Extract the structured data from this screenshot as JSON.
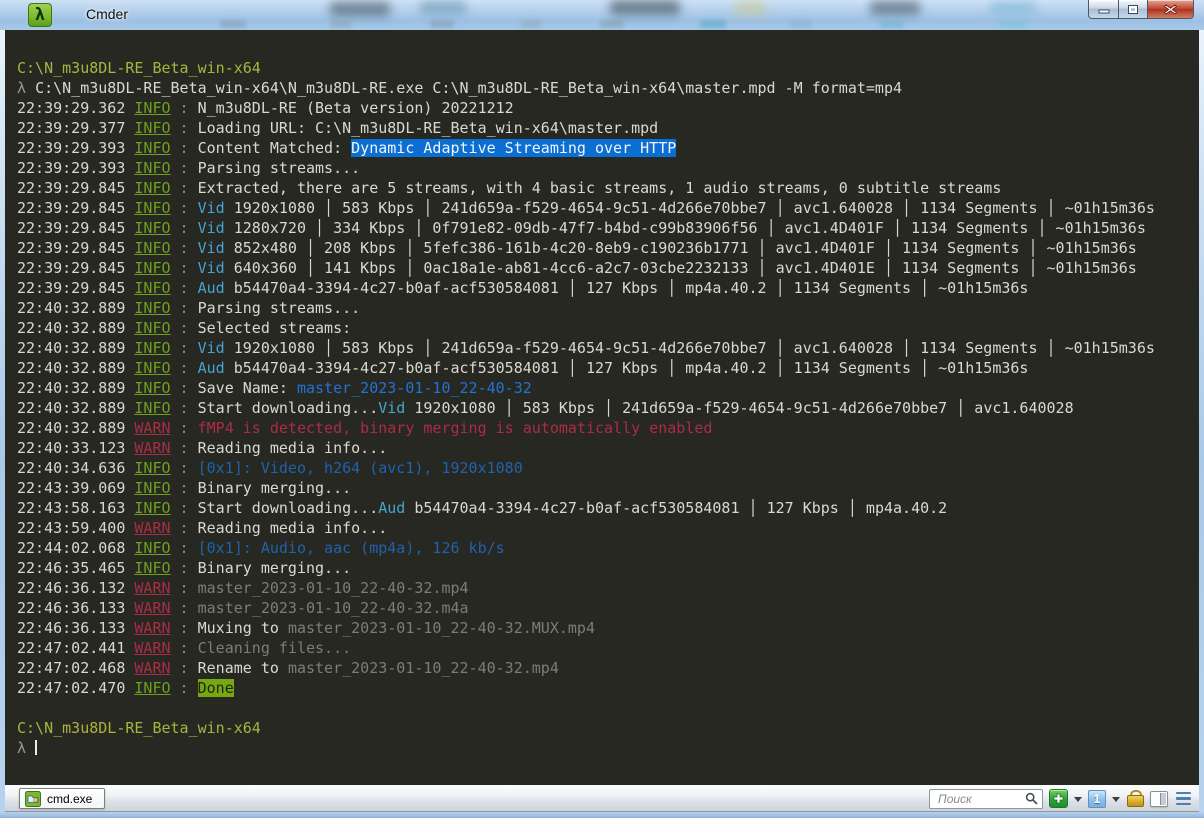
{
  "window": {
    "title": "Cmder",
    "logo_glyph": "λ",
    "buttons": [
      "minimize",
      "maximize",
      "close"
    ]
  },
  "palette": {
    "bg": "#272822",
    "fg": "#d9d9d0",
    "dim": "#7d7d74",
    "path": "#a9b43f",
    "lambda": "#9a9a92",
    "sep": "#8f8f85",
    "info": "#6fa01e",
    "warn": "#ab2c44",
    "vid": "#45a3cf",
    "link": "#2272d4",
    "binfo": "#1f63ae",
    "hl_bg": "#0a6ed2",
    "hl_fg": "#f2f6fa",
    "done_bg": "#76a812",
    "done_fg": "#1e2414",
    "logo_green": "#7cb82f",
    "close_red": "#c0452f"
  },
  "terminal": {
    "lines": [
      [
        {
          "t": "C:\\N_m3u8DL-RE_Beta_win-x64",
          "s": "path"
        }
      ],
      [
        {
          "t": "λ ",
          "s": "lambda"
        },
        {
          "t": "C:\\N_m3u8DL-RE_Beta_win-x64\\N_m3u8DL-RE.exe C:\\N_m3u8DL-RE_Beta_win-x64\\master.mpd -M format=mp4",
          "s": "default"
        }
      ],
      [
        {
          "t": "22:39:29.362 ",
          "s": "default"
        },
        {
          "t": "INFO",
          "s": "info"
        },
        {
          "t": " : ",
          "s": "sep"
        },
        {
          "t": "N_m3u8DL-RE (Beta version) 20221212",
          "s": "default"
        }
      ],
      [
        {
          "t": "22:39:29.377 ",
          "s": "default"
        },
        {
          "t": "INFO",
          "s": "info"
        },
        {
          "t": " : ",
          "s": "sep"
        },
        {
          "t": "Loading URL: C:\\N_m3u8DL-RE_Beta_win-x64\\master.mpd",
          "s": "default"
        }
      ],
      [
        {
          "t": "22:39:29.393 ",
          "s": "default"
        },
        {
          "t": "INFO",
          "s": "info"
        },
        {
          "t": " : ",
          "s": "sep"
        },
        {
          "t": "Content Matched: ",
          "s": "default"
        },
        {
          "t": "Dynamic Adaptive Streaming over HTTP",
          "s": "hl"
        }
      ],
      [
        {
          "t": "22:39:29.393 ",
          "s": "default"
        },
        {
          "t": "INFO",
          "s": "info"
        },
        {
          "t": " : ",
          "s": "sep"
        },
        {
          "t": "Parsing streams...",
          "s": "default"
        }
      ],
      [
        {
          "t": "22:39:29.845 ",
          "s": "default"
        },
        {
          "t": "INFO",
          "s": "info"
        },
        {
          "t": " : ",
          "s": "sep"
        },
        {
          "t": "Extracted, there are 5 streams, with 4 basic streams, 1 audio streams, 0 subtitle streams",
          "s": "default"
        }
      ],
      [
        {
          "t": "22:39:29.845 ",
          "s": "default"
        },
        {
          "t": "INFO",
          "s": "info"
        },
        {
          "t": " : ",
          "s": "sep"
        },
        {
          "t": "Vid",
          "s": "vid"
        },
        {
          "t": " 1920x1080 │ 583 Kbps │ 241d659a-f529-4654-9c51-4d266e70bbe7 │ avc1.640028 │ 1134 Segments │ ~01h15m36s",
          "s": "default"
        }
      ],
      [
        {
          "t": "22:39:29.845 ",
          "s": "default"
        },
        {
          "t": "INFO",
          "s": "info"
        },
        {
          "t": " : ",
          "s": "sep"
        },
        {
          "t": "Vid",
          "s": "vid"
        },
        {
          "t": " 1280x720 │ 334 Kbps │ 0f791e82-09db-47f7-b4bd-c99b83906f56 │ avc1.4D401F │ 1134 Segments │ ~01h15m36s",
          "s": "default"
        }
      ],
      [
        {
          "t": "22:39:29.845 ",
          "s": "default"
        },
        {
          "t": "INFO",
          "s": "info"
        },
        {
          "t": " : ",
          "s": "sep"
        },
        {
          "t": "Vid",
          "s": "vid"
        },
        {
          "t": " 852x480 │ 208 Kbps │ 5fefc386-161b-4c20-8eb9-c190236b1771 │ avc1.4D401F │ 1134 Segments │ ~01h15m36s",
          "s": "default"
        }
      ],
      [
        {
          "t": "22:39:29.845 ",
          "s": "default"
        },
        {
          "t": "INFO",
          "s": "info"
        },
        {
          "t": " : ",
          "s": "sep"
        },
        {
          "t": "Vid",
          "s": "vid"
        },
        {
          "t": " 640x360 │ 141 Kbps │ 0ac18a1e-ab81-4cc6-a2c7-03cbe2232133 │ avc1.4D401E │ 1134 Segments │ ~01h15m36s",
          "s": "default"
        }
      ],
      [
        {
          "t": "22:39:29.845 ",
          "s": "default"
        },
        {
          "t": "INFO",
          "s": "info"
        },
        {
          "t": " : ",
          "s": "sep"
        },
        {
          "t": "Aud",
          "s": "vid"
        },
        {
          "t": " b54470a4-3394-4c27-b0af-acf530584081 │ 127 Kbps │ mp4a.40.2 │ 1134 Segments │ ~01h15m36s",
          "s": "default"
        }
      ],
      [
        {
          "t": "22:40:32.889 ",
          "s": "default"
        },
        {
          "t": "INFO",
          "s": "info"
        },
        {
          "t": " : ",
          "s": "sep"
        },
        {
          "t": "Parsing streams...",
          "s": "default"
        }
      ],
      [
        {
          "t": "22:40:32.889 ",
          "s": "default"
        },
        {
          "t": "INFO",
          "s": "info"
        },
        {
          "t": " : ",
          "s": "sep"
        },
        {
          "t": "Selected streams:",
          "s": "default"
        }
      ],
      [
        {
          "t": "22:40:32.889 ",
          "s": "default"
        },
        {
          "t": "INFO",
          "s": "info"
        },
        {
          "t": " : ",
          "s": "sep"
        },
        {
          "t": "Vid",
          "s": "vid"
        },
        {
          "t": " 1920x1080 │ 583 Kbps │ 241d659a-f529-4654-9c51-4d266e70bbe7 │ avc1.640028 │ 1134 Segments │ ~01h15m36s",
          "s": "default"
        }
      ],
      [
        {
          "t": "22:40:32.889 ",
          "s": "default"
        },
        {
          "t": "INFO",
          "s": "info"
        },
        {
          "t": " : ",
          "s": "sep"
        },
        {
          "t": "Aud",
          "s": "vid"
        },
        {
          "t": " b54470a4-3394-4c27-b0af-acf530584081 │ 127 Kbps │ mp4a.40.2 │ 1134 Segments │ ~01h15m36s",
          "s": "default"
        }
      ],
      [
        {
          "t": "22:40:32.889 ",
          "s": "default"
        },
        {
          "t": "INFO",
          "s": "info"
        },
        {
          "t": " : ",
          "s": "sep"
        },
        {
          "t": "Save Name: ",
          "s": "default"
        },
        {
          "t": "master_2023-01-10_22-40-32",
          "s": "link"
        }
      ],
      [
        {
          "t": "22:40:32.889 ",
          "s": "default"
        },
        {
          "t": "INFO",
          "s": "info"
        },
        {
          "t": " : ",
          "s": "sep"
        },
        {
          "t": "Start downloading...",
          "s": "default"
        },
        {
          "t": "Vid",
          "s": "vid"
        },
        {
          "t": " 1920x1080 │ 583 Kbps │ 241d659a-f529-4654-9c51-4d266e70bbe7 │ avc1.640028",
          "s": "default"
        }
      ],
      [
        {
          "t": "22:40:32.889 ",
          "s": "default"
        },
        {
          "t": "WARN",
          "s": "warn"
        },
        {
          "t": " : ",
          "s": "sep"
        },
        {
          "t": "fMP4 is detected, binary merging is automatically enabled",
          "s": "warntext"
        }
      ],
      [
        {
          "t": "22:40:33.123 ",
          "s": "default"
        },
        {
          "t": "WARN",
          "s": "warn"
        },
        {
          "t": " : ",
          "s": "sep"
        },
        {
          "t": "Reading media info...",
          "s": "default"
        }
      ],
      [
        {
          "t": "22:40:34.636 ",
          "s": "default"
        },
        {
          "t": "INFO",
          "s": "info"
        },
        {
          "t": " : ",
          "s": "sep"
        },
        {
          "t": "[0x1]: Video, h264 (avc1), 1920x1080",
          "s": "binfo"
        }
      ],
      [
        {
          "t": "22:43:39.069 ",
          "s": "default"
        },
        {
          "t": "INFO",
          "s": "info"
        },
        {
          "t": " : ",
          "s": "sep"
        },
        {
          "t": "Binary merging...",
          "s": "default"
        }
      ],
      [
        {
          "t": "22:43:58.163 ",
          "s": "default"
        },
        {
          "t": "INFO",
          "s": "info"
        },
        {
          "t": " : ",
          "s": "sep"
        },
        {
          "t": "Start downloading...",
          "s": "default"
        },
        {
          "t": "Aud",
          "s": "vid"
        },
        {
          "t": " b54470a4-3394-4c27-b0af-acf530584081 │ 127 Kbps │ mp4a.40.2",
          "s": "default"
        }
      ],
      [
        {
          "t": "22:43:59.400 ",
          "s": "default"
        },
        {
          "t": "WARN",
          "s": "warn"
        },
        {
          "t": " : ",
          "s": "sep"
        },
        {
          "t": "Reading media info...",
          "s": "default"
        }
      ],
      [
        {
          "t": "22:44:02.068 ",
          "s": "default"
        },
        {
          "t": "INFO",
          "s": "info"
        },
        {
          "t": " : ",
          "s": "sep"
        },
        {
          "t": "[0x1]: Audio, aac (mp4a), 126 kb/s",
          "s": "binfo"
        }
      ],
      [
        {
          "t": "22:46:35.465 ",
          "s": "default"
        },
        {
          "t": "INFO",
          "s": "info"
        },
        {
          "t": " : ",
          "s": "sep"
        },
        {
          "t": "Binary merging...",
          "s": "default"
        }
      ],
      [
        {
          "t": "22:46:36.132 ",
          "s": "default"
        },
        {
          "t": "WARN",
          "s": "warn"
        },
        {
          "t": " : ",
          "s": "sep"
        },
        {
          "t": "master_2023-01-10_22-40-32.mp4",
          "s": "dim"
        }
      ],
      [
        {
          "t": "22:46:36.133 ",
          "s": "default"
        },
        {
          "t": "WARN",
          "s": "warn"
        },
        {
          "t": " : ",
          "s": "sep"
        },
        {
          "t": "master_2023-01-10_22-40-32.m4a",
          "s": "dim"
        }
      ],
      [
        {
          "t": "22:46:36.133 ",
          "s": "default"
        },
        {
          "t": "WARN",
          "s": "warn"
        },
        {
          "t": " : ",
          "s": "sep"
        },
        {
          "t": "Muxing to ",
          "s": "default"
        },
        {
          "t": "master_2023-01-10_22-40-32.MUX.mp4",
          "s": "dim"
        }
      ],
      [
        {
          "t": "22:47:02.441 ",
          "s": "default"
        },
        {
          "t": "WARN",
          "s": "warn"
        },
        {
          "t": " : ",
          "s": "sep"
        },
        {
          "t": "Cleaning files...",
          "s": "dim"
        }
      ],
      [
        {
          "t": "22:47:02.468 ",
          "s": "default"
        },
        {
          "t": "WARN",
          "s": "warn"
        },
        {
          "t": " : ",
          "s": "sep"
        },
        {
          "t": "Rename to ",
          "s": "default"
        },
        {
          "t": "master_2023-01-10_22-40-32.mp4",
          "s": "dim"
        }
      ],
      [
        {
          "t": "22:47:02.470 ",
          "s": "default"
        },
        {
          "t": "INFO",
          "s": "info"
        },
        {
          "t": " : ",
          "s": "sep"
        },
        {
          "t": "Done",
          "s": "done"
        }
      ],
      [],
      [
        {
          "t": "C:\\N_m3u8DL-RE_Beta_win-x64",
          "s": "path"
        }
      ],
      [
        {
          "t": "λ ",
          "s": "lambda"
        },
        {
          "t": "",
          "s": "cursor"
        }
      ]
    ]
  },
  "statusbar": {
    "tab_label": "cmd.exe",
    "search_placeholder": "Поиск",
    "console_number": "1"
  }
}
